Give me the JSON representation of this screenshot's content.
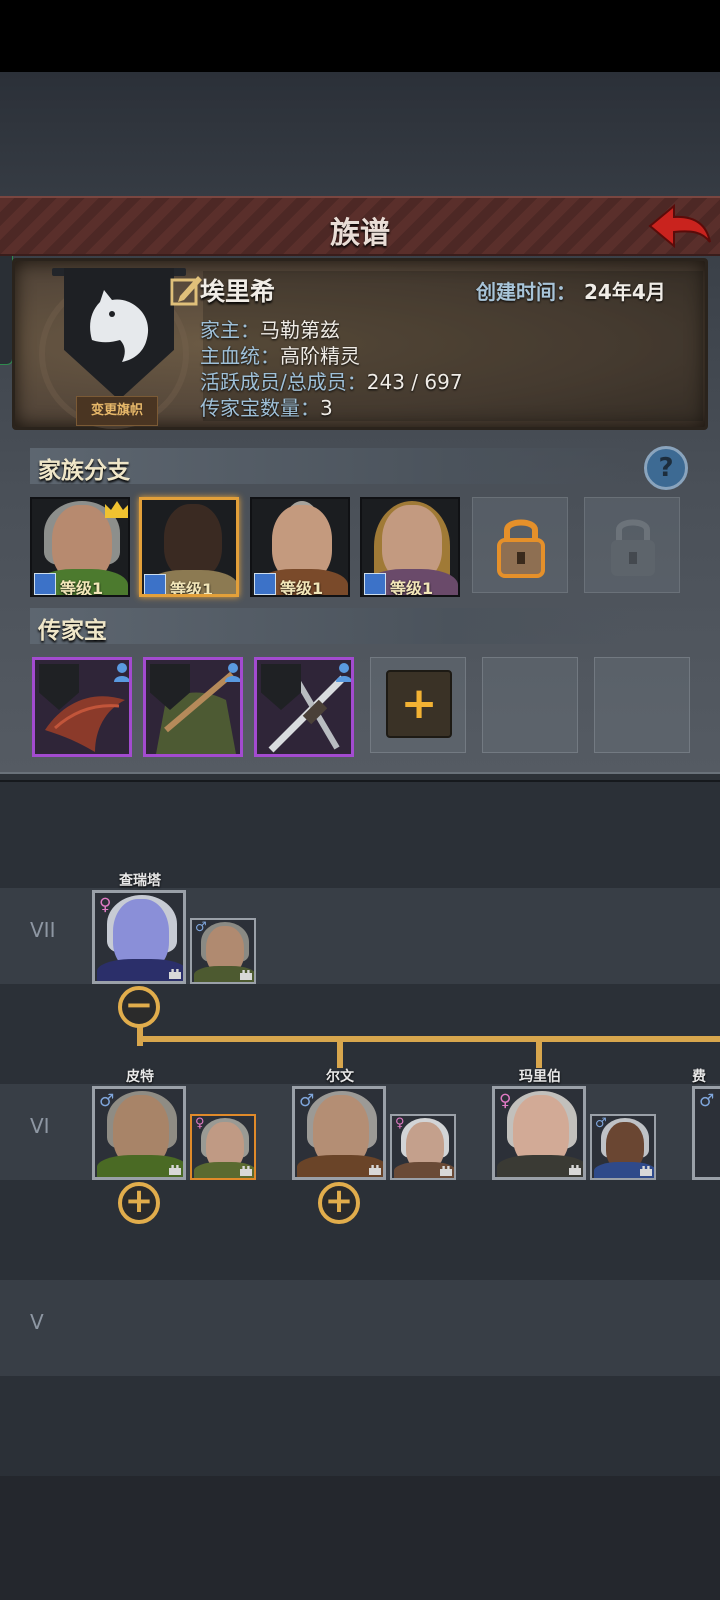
{
  "header": {
    "title": "族谱"
  },
  "family": {
    "name": "埃里希",
    "created_label": "创建时间：",
    "created_value": "24年4月",
    "head_label": "家主：",
    "head_value": "马勒第兹",
    "bloodline_label": "主血统：",
    "bloodline_value": "高阶精灵",
    "members_label": "活跃成员/总成员：",
    "members_value": "243 / 697",
    "heirlooms_label": "传家宝数量：",
    "heirlooms_value": "3",
    "change_banner_label": "变更旗帜"
  },
  "branches": {
    "title": "家族分支",
    "help_label": "?",
    "items": [
      {
        "level": "等级1",
        "leader": true,
        "selected": false
      },
      {
        "level": "等级1",
        "leader": false,
        "selected": true
      },
      {
        "level": "等级1",
        "leader": false,
        "selected": false
      },
      {
        "level": "等级1",
        "leader": false,
        "selected": false
      }
    ],
    "locked_slots": [
      "unlockable",
      "locked"
    ]
  },
  "heirlooms": {
    "title": "传家宝",
    "items": [
      {
        "icon": "red-wing-blade-icon"
      },
      {
        "icon": "green-cloak-sword-icon"
      },
      {
        "icon": "crossed-swords-icon"
      }
    ],
    "add_label": "+"
  },
  "tree": {
    "generations": [
      {
        "roman": "VII"
      },
      {
        "roman": "VI"
      },
      {
        "roman": "V"
      }
    ],
    "gen7": {
      "name": "查瑞塔",
      "gender": "♀",
      "spouse_gender": "♂",
      "toggle": "−"
    },
    "gen6": [
      {
        "name": "皮特",
        "gender": "♂",
        "spouse_gender": "♀",
        "toggle": "+"
      },
      {
        "name": "尔文",
        "gender": "♂",
        "spouse_gender": "♀",
        "toggle": "+"
      },
      {
        "name": "玛里伯",
        "gender": "♀",
        "spouse_gender": "♂"
      },
      {
        "name": "费",
        "gender": "♂"
      }
    ]
  }
}
